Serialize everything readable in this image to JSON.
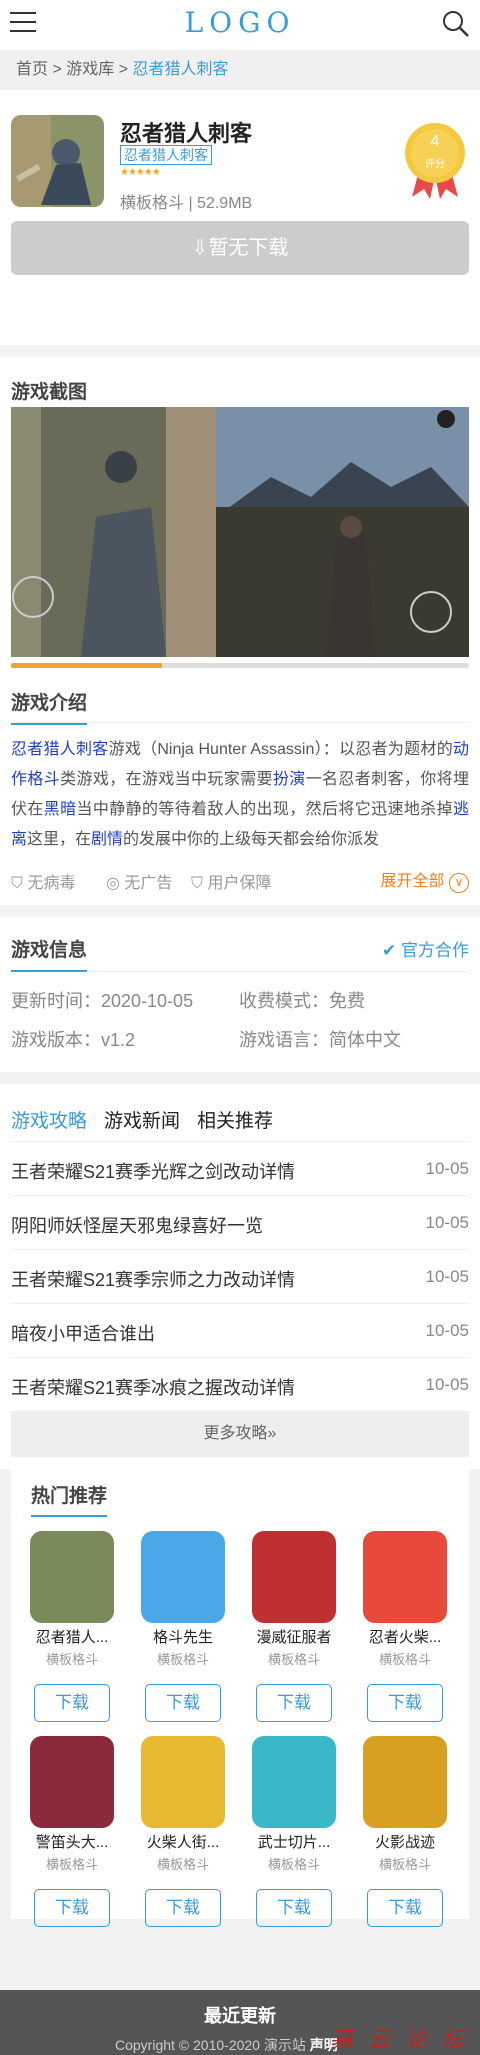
{
  "header": {
    "logo": "LOGO"
  },
  "breadcrumb": {
    "home": "首页",
    "sep1": " > ",
    "lib": "游戏库",
    "sep2": " > ",
    "current": "忍者猎人刺客"
  },
  "app": {
    "name": "忍者猎人刺客",
    "tag": "忍者猎人刺客",
    "stars": "★★★★★",
    "meta": "横板格斗 | 52.9MB",
    "rating": "4",
    "rating_label": "评分",
    "download": "暂无下载"
  },
  "screenshots": {
    "title": "游戏截图",
    "progress": 0.33
  },
  "intro": {
    "title": "游戏介绍",
    "parts": [
      {
        "t": "忍者猎人刺客",
        "link": true
      },
      {
        "t": "游戏（Ninja Hunter Assassin）：以忍者为题材的",
        "link": false
      },
      {
        "t": "动作格斗",
        "link": true
      },
      {
        "t": "类游戏，在游戏当中玩家需要",
        "link": false
      },
      {
        "t": "扮演",
        "link": true
      },
      {
        "t": "一名忍者刺客，你将埋伏在",
        "link": false
      },
      {
        "t": "黑暗",
        "link": true
      },
      {
        "t": "当中静静的等待着敌人的出现，然后将它迅速地杀掉",
        "link": false
      },
      {
        "t": "逃离",
        "link": true
      },
      {
        "t": "这里，在",
        "link": false
      },
      {
        "t": "剧情",
        "link": true
      },
      {
        "t": "的发展中你的上级每天都会给你派发",
        "link": false
      }
    ],
    "badges": [
      "无病毒",
      "无广告",
      "用户保障"
    ],
    "expand": "展开全部"
  },
  "info": {
    "title": "游戏信息",
    "official": "官方合作",
    "update_label": "更新时间：2020-10-05",
    "fee_label": "收费模式：免费",
    "version_label": "游戏版本：v1.2",
    "lang_label": "游戏语言：简体中文"
  },
  "tabs": [
    "游戏攻略",
    "游戏新闻",
    "相关推荐"
  ],
  "news": [
    {
      "title": "王者荣耀S21赛季光辉之剑改动详情",
      "date": "10-05"
    },
    {
      "title": "阴阳师妖怪屋天邪鬼绿喜好一览",
      "date": "10-05"
    },
    {
      "title": "王者荣耀S21赛季宗师之力改动详情",
      "date": "10-05"
    },
    {
      "title": "暗夜小甲适合谁出",
      "date": "10-05"
    },
    {
      "title": "王者荣耀S21赛季冰痕之握改动详情",
      "date": "10-05"
    }
  ],
  "more": "更多攻略»",
  "hot": {
    "title": "热门推荐",
    "download": "下载",
    "items": [
      {
        "name": "忍者猎人...",
        "type": "横板格斗",
        "color": "#7a8a5a"
      },
      {
        "name": "格斗先生",
        "type": "横板格斗",
        "color": "#4aa8e8"
      },
      {
        "name": "漫威征服者",
        "type": "横板格斗",
        "color": "#c03030"
      },
      {
        "name": "忍者火柴...",
        "type": "横板格斗",
        "color": "#e84a3a"
      },
      {
        "name": "警笛头大...",
        "type": "横板格斗",
        "color": "#8a2a3a"
      },
      {
        "name": "火柴人街...",
        "type": "横板格斗",
        "color": "#e8b830"
      },
      {
        "name": "武士切片...",
        "type": "横板格斗",
        "color": "#3ab8c8"
      },
      {
        "name": "火影战迹",
        "type": "横板格斗",
        "color": "#d8a020"
      }
    ]
  },
  "footer": {
    "title": "最近更新",
    "copyright": "Copyright © 2010-2020 演示站",
    "statement": "声明"
  },
  "watermark": "慕 云 论 坛"
}
